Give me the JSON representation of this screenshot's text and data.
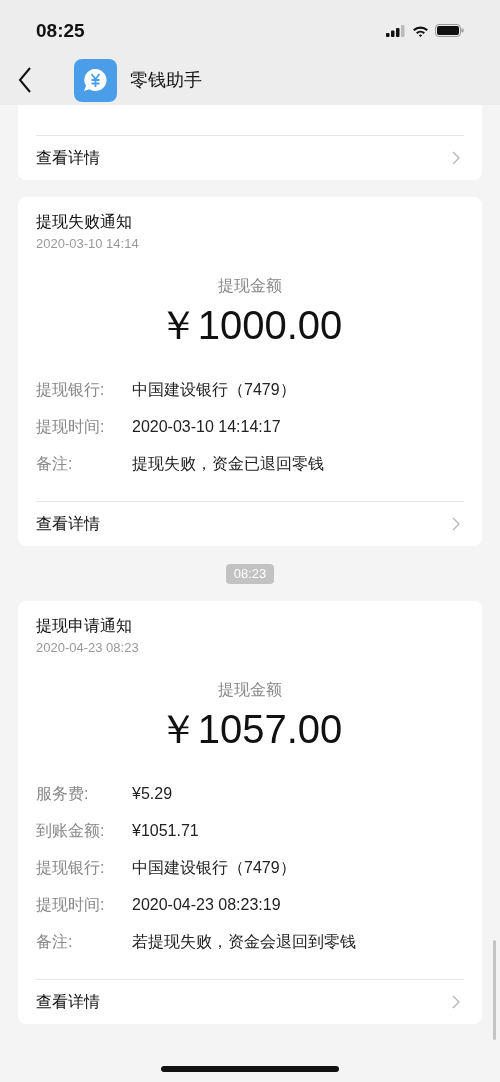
{
  "status_bar": {
    "time": "08:25"
  },
  "header": {
    "title": "零钱助手"
  },
  "messages": [
    {
      "kind": "partial",
      "link": "查看详情"
    },
    {
      "kind": "notice",
      "title": "提现失败通知",
      "date": "2020-03-10 14:14",
      "amount_label": "提现金额",
      "amount": "￥1000.00",
      "rows": [
        {
          "label": "提现银行:",
          "value": "中国建设银行（7479）"
        },
        {
          "label": "提现时间:",
          "value": "2020-03-10 14:14:17"
        },
        {
          "label": "备注:",
          "value": "提现失败，资金已退回零钱"
        }
      ],
      "link": "查看详情"
    },
    {
      "kind": "time",
      "time": "08:23"
    },
    {
      "kind": "notice",
      "title": "提现申请通知",
      "date": "2020-04-23 08:23",
      "amount_label": "提现金额",
      "amount": "￥1057.00",
      "rows": [
        {
          "label": "服务费:",
          "value": "¥5.29"
        },
        {
          "label": "到账金额:",
          "value": "¥1051.71"
        },
        {
          "label": "提现银行:",
          "value": "中国建设银行（7479）"
        },
        {
          "label": "提现时间:",
          "value": "2020-04-23 08:23:19"
        },
        {
          "label": "备注:",
          "value": "若提现失败，资金会退回到零钱"
        }
      ],
      "link": "查看详情"
    }
  ]
}
